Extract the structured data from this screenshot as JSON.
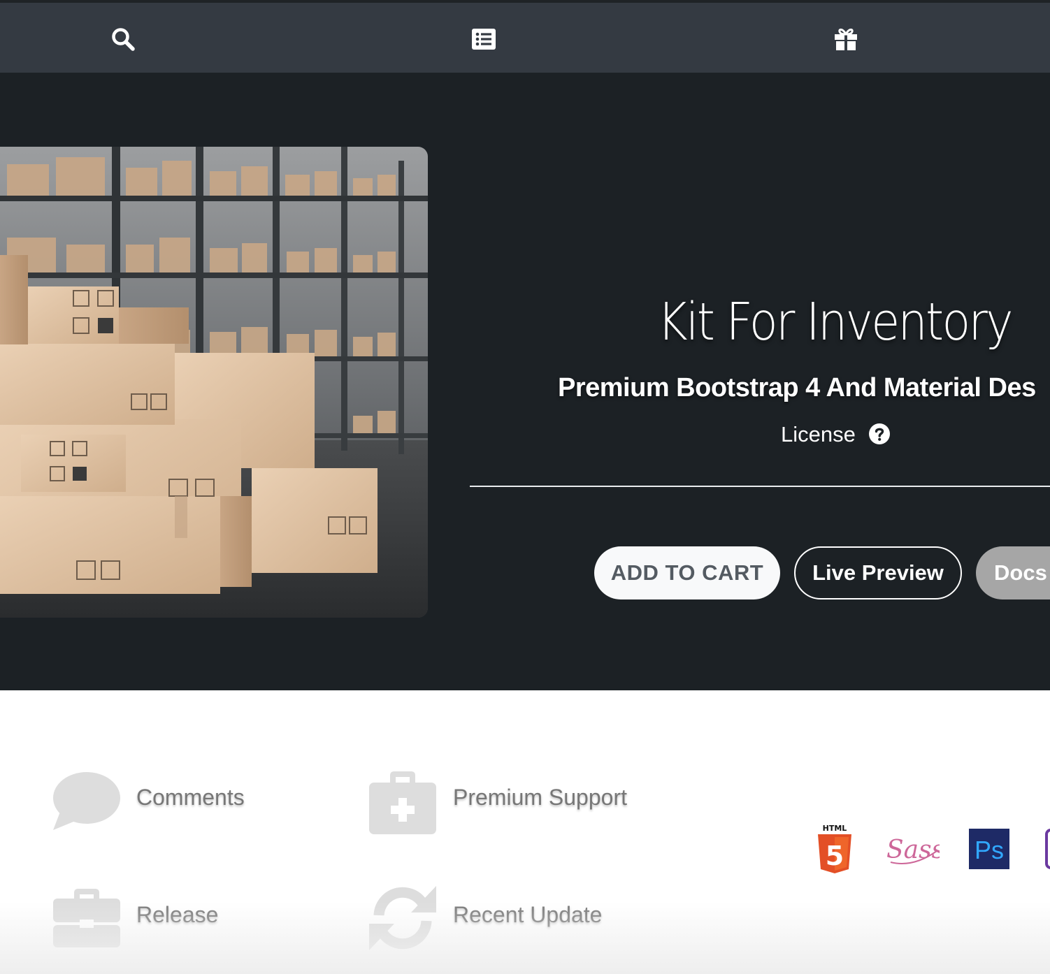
{
  "navbar": {
    "items": [
      {
        "icon": "search-icon"
      },
      {
        "icon": "list-icon"
      },
      {
        "icon": "gift-icon"
      }
    ]
  },
  "hero": {
    "title": "Kit For Inventory",
    "subtitle": "Premium Bootstrap 4 And Material Des",
    "license_label": "License",
    "buttons": {
      "add_to_cart": "ADD TO CART",
      "live_preview": "Live Preview",
      "docs": "Docs"
    }
  },
  "features": {
    "comments": "Comments",
    "premium_support": "Premium Support",
    "release": "Release",
    "recent_update": "Recent Update"
  },
  "tech_logos": {
    "html5_caption": "HTML",
    "html5_glyph": "5",
    "sass": "Sass",
    "photoshop": "Ps"
  },
  "colors": {
    "navbar_bg": "#343a42",
    "hero_bg": "#1c2125",
    "feature_icon": "#dddddd",
    "feature_text": "#777777",
    "html5_orange": "#e34f26",
    "sass_pink": "#cd6799",
    "ps_navy": "#1e2a66",
    "ps_blue": "#31a8ff"
  }
}
